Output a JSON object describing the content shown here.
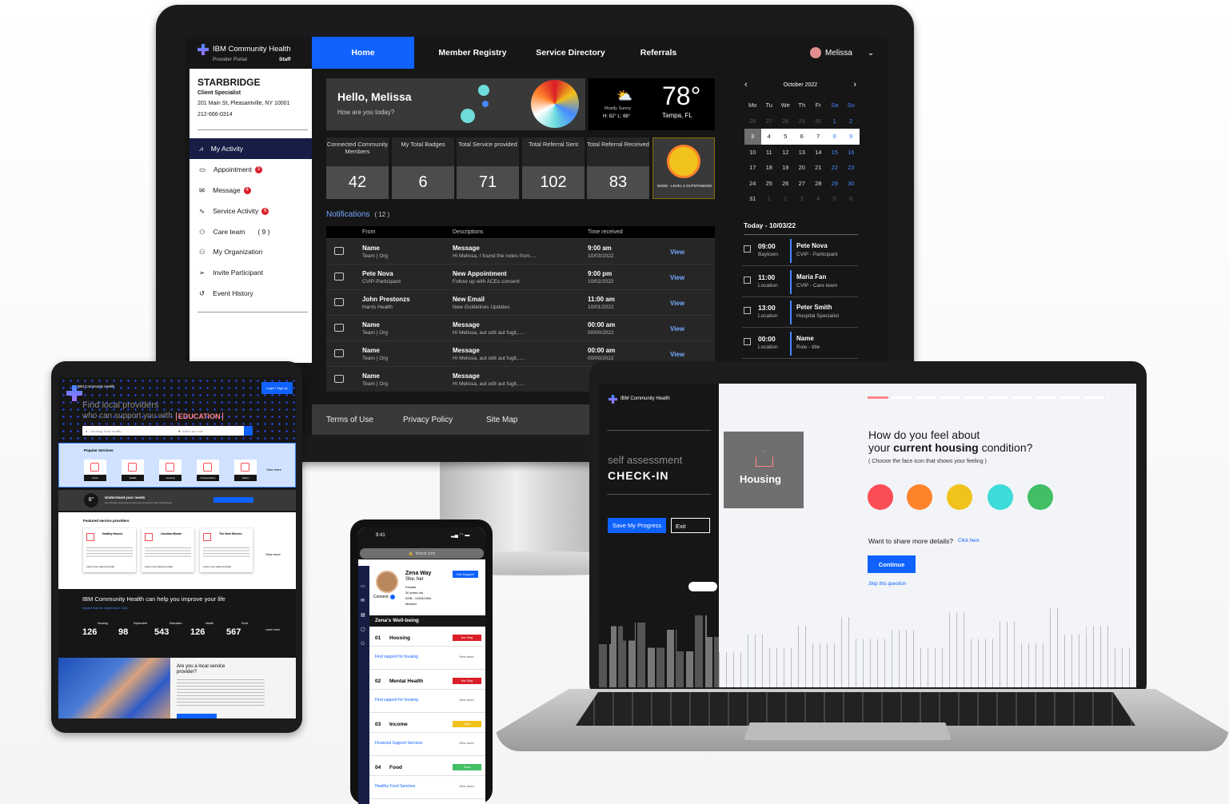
{
  "colors": {
    "accent": "#0f62fe",
    "dark": "#161616",
    "danger": "#da1e28"
  },
  "monitor": {
    "brand": "IBM Community Health",
    "portal": "Provider Portal",
    "role": "Staff",
    "nav": [
      "Home",
      "Member Registry",
      "Service Directory",
      "Referrals"
    ],
    "user": "Melissa",
    "org": {
      "name": "STARBRIDGE",
      "title": "Client Specialist",
      "address": "201 Main St, Pleasantville, NY 10001",
      "phone": "212-666-0314"
    },
    "side": [
      {
        "label": "My Activity",
        "badge": ""
      },
      {
        "label": "Appointment",
        "badge": "3"
      },
      {
        "label": "Message",
        "badge": "4"
      },
      {
        "label": "Service Activity",
        "badge": "6"
      },
      {
        "label": "Care team",
        "badge": "( 9 )"
      },
      {
        "label": "My Organization",
        "badge": ""
      },
      {
        "label": "Invite Participant",
        "badge": ""
      },
      {
        "label": "Event History",
        "badge": ""
      }
    ],
    "hello": "Hello, Melissa",
    "hello_sub": "How are you today?",
    "weather": {
      "temp": "78°",
      "loc": "Tampa, FL",
      "desc": "Mostly Sunny",
      "hilo": "H: 82°  L: 68°"
    },
    "stats": [
      {
        "label": "Connected Community Members",
        "value": "42"
      },
      {
        "label": "My Total Badges",
        "value": "6"
      },
      {
        "label": "Total Service provided",
        "value": "71"
      },
      {
        "label": "Total Referral Sent",
        "value": "102"
      },
      {
        "label": "Total Referral Received",
        "value": "83"
      }
    ],
    "badge_text": "ISSUE - LEVEL 5 OUTSTANDING",
    "notifications_title": "Notifications",
    "notifications_count": "( 12 )",
    "nt_headers": [
      "From",
      "Descriptions",
      "Time received"
    ],
    "nt_rows": [
      {
        "from": "Name",
        "from_sub": "Team | Org",
        "desc": "Message",
        "desc_sub": "Hi Melissa, I found the notes from....",
        "time": "9:00 am",
        "date": "10/03/2022",
        "action": "View"
      },
      {
        "from": "Pete Nova",
        "from_sub": "CVIP-Participant",
        "desc": "New Appointment",
        "desc_sub": "Follow up with ACEs consent",
        "time": "9:00 pm",
        "date": "10/02/2022",
        "action": "View"
      },
      {
        "from": "John Prestonzs",
        "from_sub": "Harris Health",
        "desc": "New Email",
        "desc_sub": "New Guidelines Updates",
        "time": "11:00 am",
        "date": "10/01/2022",
        "action": "View"
      },
      {
        "from": "Name",
        "from_sub": "Team | Org",
        "desc": "Message",
        "desc_sub": "Hi Melissa, aut odit aut fugit,.....",
        "time": "00:00 am",
        "date": "00/00/2022",
        "action": "View"
      },
      {
        "from": "Name",
        "from_sub": "Team | Org",
        "desc": "Message",
        "desc_sub": "Hi Melissa, aut odit aut fugit,.....",
        "time": "00:00 am",
        "date": "00/00/2022",
        "action": "View"
      },
      {
        "from": "Name",
        "from_sub": "Team | Org",
        "desc": "Message",
        "desc_sub": "Hi Melissa, aut odit aut fugit,.....",
        "time": "",
        "date": "",
        "action": ""
      }
    ],
    "calendar": {
      "month": "October 2022",
      "days": [
        "Mo",
        "Tu",
        "We",
        "Th",
        "Fr",
        "Sa",
        "Su"
      ],
      "weeks": [
        [
          "26",
          "27",
          "28",
          "29",
          "30",
          "1",
          "2"
        ],
        [
          "3",
          "4",
          "5",
          "6",
          "7",
          "8",
          "9"
        ],
        [
          "10",
          "11",
          "12",
          "13",
          "14",
          "15",
          "16"
        ],
        [
          "17",
          "18",
          "19",
          "20",
          "21",
          "22",
          "23"
        ],
        [
          "24",
          "25",
          "26",
          "27",
          "28",
          "29",
          "30"
        ],
        [
          "31",
          "1",
          "2",
          "3",
          "4",
          "5",
          "6"
        ]
      ]
    },
    "today": "Today - 10/03/22",
    "appts": [
      {
        "time": "09:00",
        "place": "Baytown",
        "name": "Pete Nova",
        "role": "CVIP - Participant"
      },
      {
        "time": "11:00",
        "place": "Location",
        "name": "Maria Fan",
        "role": "CVIP - Care team"
      },
      {
        "time": "13:00",
        "place": "Location",
        "name": "Peter Smith",
        "role": "Hospital Specialist"
      },
      {
        "time": "00:00",
        "place": "Location",
        "name": "Name",
        "role": "Role - title"
      }
    ],
    "footer": [
      "Terms of Use",
      "Privacy Policy",
      "Site Map"
    ]
  },
  "tablet": {
    "brand": "IBM Community Health",
    "login": "Login / Sign up",
    "hero1": "Find local providers",
    "hero2": "who can support you with",
    "hero_kw": "EDUCATION",
    "search_ph": "Housing, food, health...",
    "zip_ph": "Enter zip code",
    "popular": "Popular Services",
    "services": [
      "Food",
      "Health",
      "Housing",
      "Transportation",
      "Safety"
    ],
    "view_more": "View more",
    "needs": "Understand your needs",
    "needs_sub": "We will help recommend resources as well as staff assessment.",
    "featured": "Featured service providers",
    "providers": [
      {
        "name": "Healthy Homes"
      },
      {
        "name": "Carolina Minute"
      },
      {
        "name": "The Nest Kitchen"
      }
    ],
    "learn": "Learn more about provider",
    "impact": "IBM Community Health can help you improve your life",
    "impact_sub": "Impact that we make since 2021",
    "impact_stats": [
      {
        "label": "Housing",
        "value": "126"
      },
      {
        "label": "Dependent",
        "value": "98"
      },
      {
        "label": "Education",
        "value": "543"
      },
      {
        "label": "Health",
        "value": "126"
      },
      {
        "label": "Food",
        "value": "567"
      }
    ],
    "learn_more": "Learn more",
    "provider_q": "Are you a local service provider?"
  },
  "phone": {
    "time": "9:41",
    "url": "ibmch.com",
    "name": "Zena Way",
    "pronoun": "She, her",
    "gender": "Female",
    "age": "30 years old",
    "dob": "DOB - 02/04/1994",
    "status": "Married",
    "consent": "Consent",
    "get_support": "Get Support",
    "wellbeing": "Zena's Well-being",
    "items": [
      {
        "num": "01",
        "label": "Housing",
        "status": "Not Okay",
        "status_color": "#da1e28",
        "link": "Find support for housing"
      },
      {
        "num": "02",
        "label": "Mental Health",
        "status": "Not Okay",
        "status_color": "#da1e28",
        "link": "Find support for housing"
      },
      {
        "num": "03",
        "label": "Income",
        "status": "Okay",
        "status_color": "#f1c21b",
        "link": "Financial Support Services"
      },
      {
        "num": "04",
        "label": "Food",
        "status": "Good",
        "status_color": "#42be65",
        "link": "Healthy Food Services"
      }
    ],
    "view_more": "View more"
  },
  "laptop": {
    "brand": "IBM Community Health",
    "self": "self assessment",
    "checkin": "CHECK-IN",
    "save": "Save My Progress",
    "exit": "Exit",
    "category": "Housing",
    "q1": "How do you feel about",
    "q2a": "your ",
    "q2b": "current housing",
    "q2c": " condition?",
    "hint": "( Choose the face icon that shows your feeling )",
    "share": "Want to share more details?",
    "click": "Click here",
    "continue": "Continue",
    "skip": "Skip this question"
  }
}
